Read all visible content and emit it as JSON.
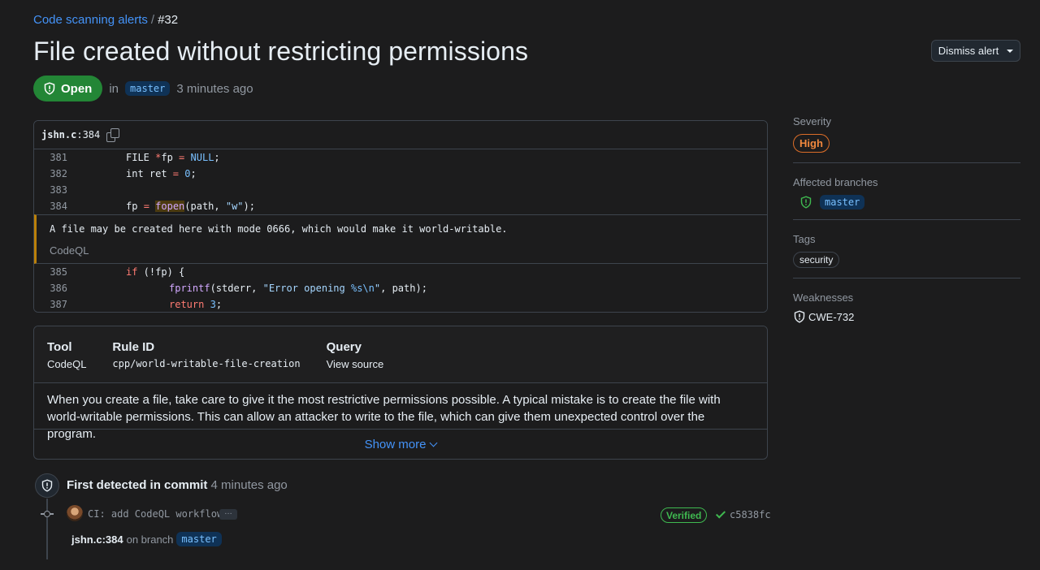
{
  "breadcrumb": {
    "parent": "Code scanning alerts",
    "separator": "/",
    "current": "#32"
  },
  "title": "File created without restricting permissions",
  "dismiss_button": "Dismiss alert",
  "status": {
    "label": "Open",
    "in": "in",
    "branch": "master",
    "time": "3 minutes ago"
  },
  "code": {
    "file": "jshn.c",
    "line_ref": ":384",
    "lines_before": [
      {
        "n": "381",
        "text": "FILE *fp = NULL;"
      },
      {
        "n": "382",
        "text": "int ret = 0;"
      },
      {
        "n": "383",
        "text": ""
      },
      {
        "n": "384",
        "text": "fp = fopen(path, \"w\");"
      }
    ],
    "alert_message": "A file may be created here with mode 0666, which would make it world-writable.",
    "alert_source": "CodeQL",
    "lines_after": [
      {
        "n": "385",
        "text": "if (!fp) {"
      },
      {
        "n": "386",
        "text": "fprintf(stderr, \"Error opening %s\\n\", path);"
      },
      {
        "n": "387",
        "text": "return 3;"
      }
    ]
  },
  "rule": {
    "tool_label": "Tool",
    "tool_value": "CodeQL",
    "rule_id_label": "Rule ID",
    "rule_id_value": "cpp/world-writable-file-creation",
    "query_label": "Query",
    "query_value": "View source",
    "description": "When you create a file, take care to give it the most restrictive permissions possible. A typical mistake is to create the file with world-writable permissions. This can allow an attacker to write to the file, which can give them unexpected control over the program.",
    "show_more": "Show more"
  },
  "timeline": {
    "title_bold": "First detected in commit",
    "title_time": "4 minutes ago",
    "commit_message": "CI: add CodeQL workflow",
    "ellipsis": "…",
    "verified": "Verified",
    "sha": "c5838fc",
    "location": "jshn.c:384",
    "on_branch": "on branch",
    "branch": "master"
  },
  "sidebar": {
    "severity_label": "Severity",
    "severity_value": "High",
    "branches_label": "Affected branches",
    "branch": "master",
    "tags_label": "Tags",
    "tag": "security",
    "weaknesses_label": "Weaknesses",
    "weakness": "CWE-732"
  },
  "colors": {
    "severity": "#f0883e",
    "open": "#238636",
    "link": "#4493f8",
    "verified": "#3fb950"
  },
  "icons": [
    "shield-check-icon",
    "copy-icon",
    "caret-down-icon",
    "chevron-down-icon",
    "shield-icon",
    "commit-icon",
    "check-icon"
  ]
}
